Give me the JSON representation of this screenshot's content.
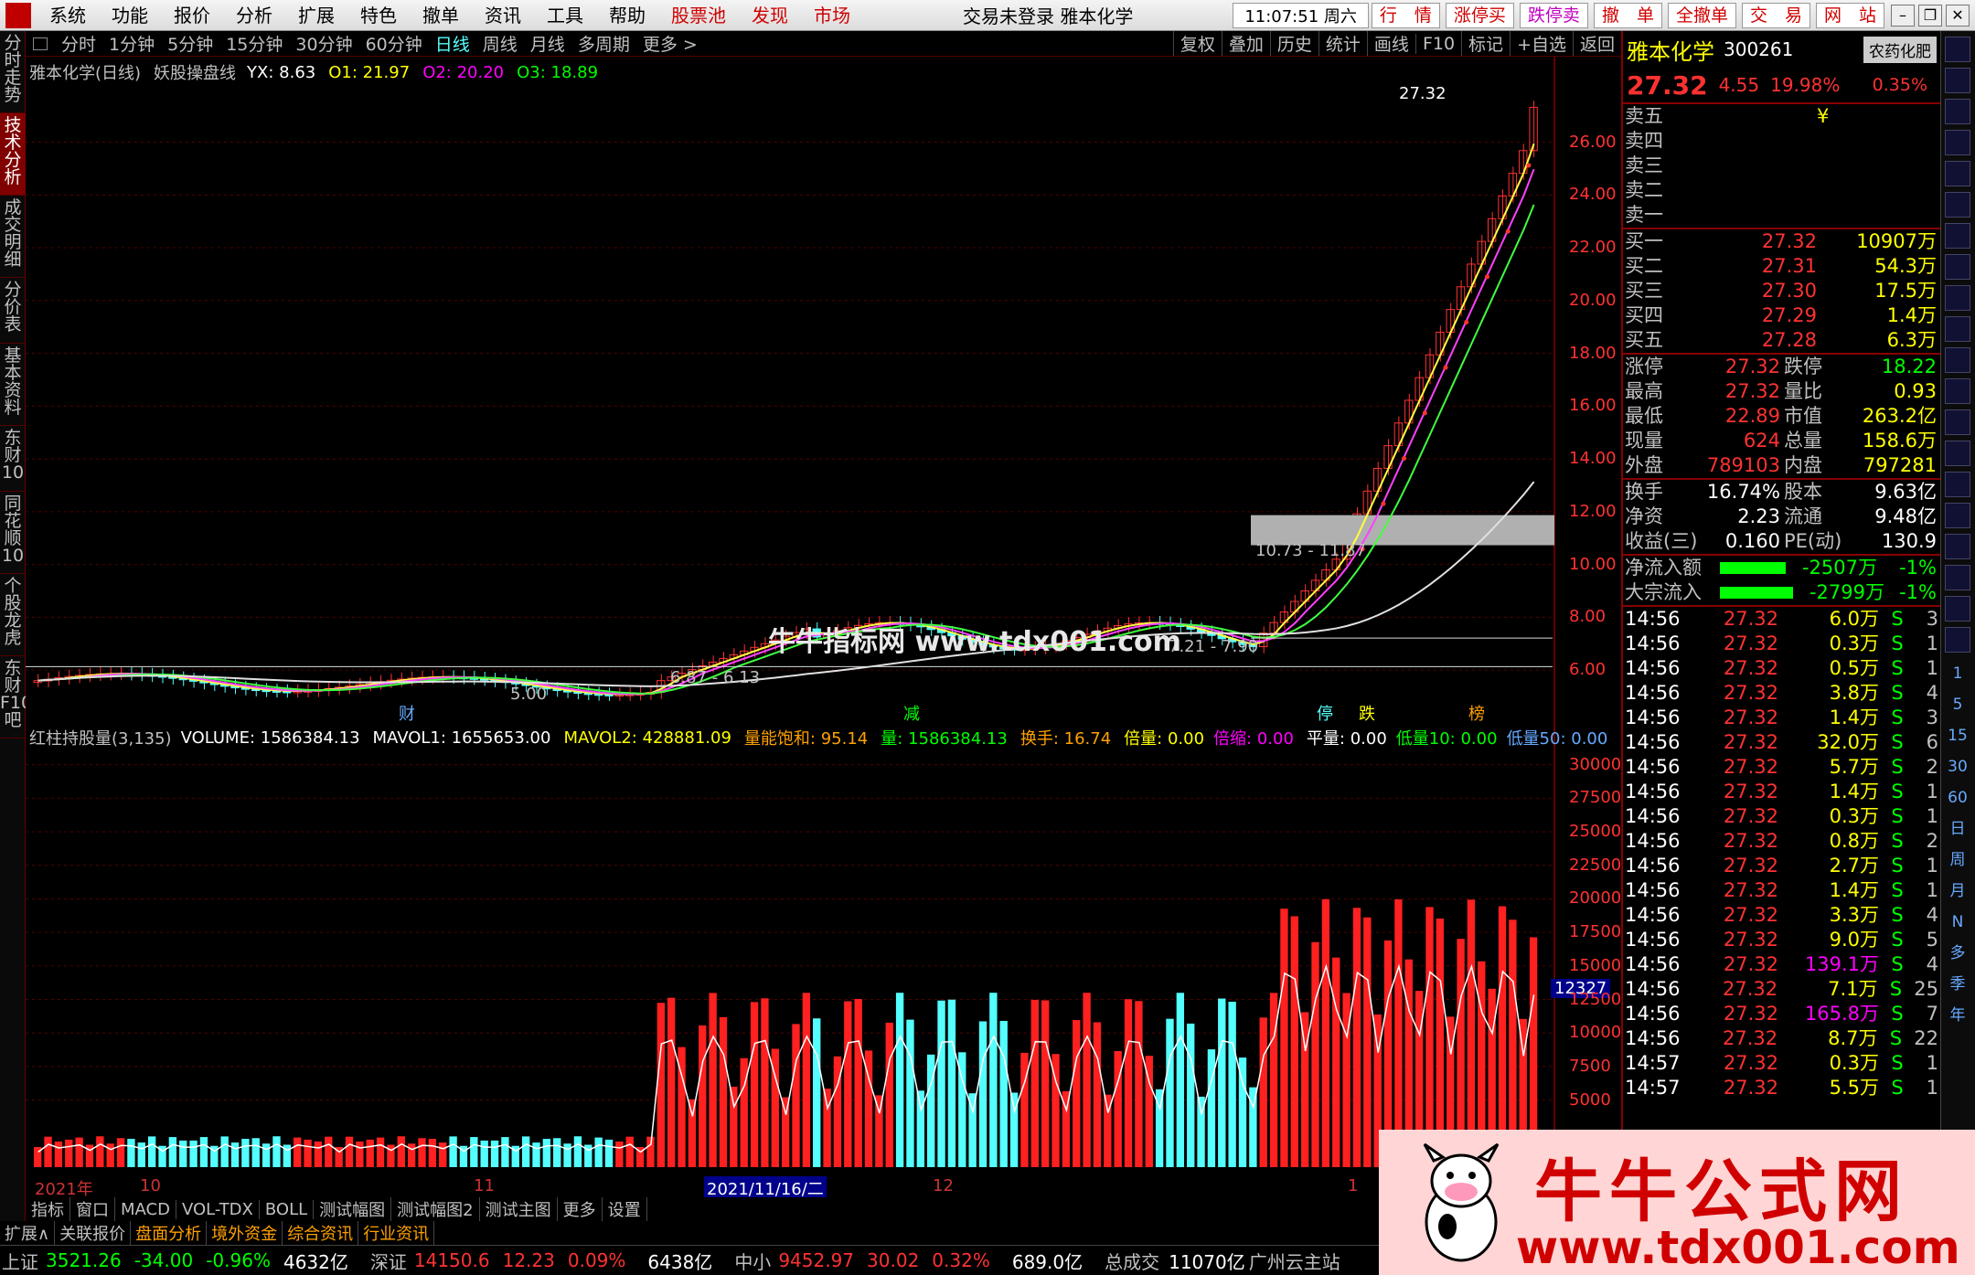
{
  "menu": {
    "items": [
      "系统",
      "功能",
      "报价",
      "分析",
      "扩展",
      "特色",
      "撤单",
      "资讯",
      "工具",
      "帮助"
    ],
    "red_items": [
      "股票池",
      "发现",
      "市场"
    ],
    "title": "交易未登录  雅本化学",
    "clock": "11:07:51 周六",
    "buttons": [
      "行　情",
      "涨停买",
      "跌停卖",
      "撤　单",
      "全撤单",
      "交　易",
      "网　站"
    ]
  },
  "left_tabs": [
    "分时走势",
    "技术分析",
    "成交明细",
    "分价表",
    "基本资料",
    "东财10",
    "同花顺10",
    "个股龙虎",
    "东财F10吧"
  ],
  "period": {
    "items": [
      "分时",
      "1分钟",
      "5分钟",
      "15分钟",
      "30分钟",
      "60分钟",
      "日线",
      "周线",
      "月线",
      "多周期",
      "更多 >"
    ],
    "active": "日线",
    "right": [
      "复权",
      "叠加",
      "历史",
      "统计",
      "画线",
      "F10",
      "标记",
      "+自选",
      "返回"
    ]
  },
  "main": {
    "stock": "雅本化学(日线)",
    "formula": "妖股操盘线",
    "yx": "YX: 8.63",
    "o1": "O1: 21.97",
    "o2": "O2: 20.20",
    "o3": "O3: 18.89",
    "price_ticks": [
      "26.00",
      "24.00",
      "22.00",
      "20.00",
      "18.00",
      "16.00",
      "14.00",
      "12.00",
      "10.00",
      "8.00",
      "6.00"
    ],
    "high_label": "27.32",
    "box_label": "10.73 - 11.87",
    "label_5_00": "5.00",
    "label_687": "6.87 - 6.13",
    "label_721": "7.21 - 7.90",
    "markers": [
      "财",
      "减",
      "停",
      "跌",
      "榜"
    ],
    "watermark": "牛牛指标网 www.tdx001.com"
  },
  "vol": {
    "name": "红柱持股量(3,135)",
    "volume": "VOLUME: 1586384.13",
    "mavol1": "MAVOL1: 1655653.00",
    "mavol2": "MAVOL2: 428881.09",
    "lnbh": "量能饱和: 95.14",
    "liang": "量: 1586384.13",
    "hs": "换手: 16.74",
    "bl": "倍量: 0.00",
    "bs": "倍缩: 0.00",
    "pl": "平量: 0.00",
    "dl": "低量10: 0.00",
    "xl": "低量50: 0.00",
    "ticks": [
      "30000",
      "27500",
      "25000",
      "22500",
      "20000",
      "17500",
      "15000",
      "12500",
      "10000",
      "7500",
      "5000"
    ],
    "cursor_val": "12327"
  },
  "dates": [
    "2021年",
    "10",
    "11",
    "2021/11/16/二",
    "12",
    "1"
  ],
  "tabs": [
    "指标",
    "窗口",
    "MACD",
    "VOL-TDX",
    "BOLL",
    "测试幅图",
    "测试幅图2",
    "测试主图",
    "更多",
    "设置"
  ],
  "sects": [
    "扩展∧",
    "关联报价",
    "盘面分析",
    "境外资金",
    "综合资讯",
    "行业资讯"
  ],
  "status": {
    "sh": "上证",
    "sh_v": "3521.26",
    "sh_c": "-34.00",
    "sh_p": "-0.96%",
    "sh_a": "4632亿",
    "sz": "深证",
    "sz_v": "14150.6",
    "sz_c": "12.23",
    "sz_p": "0.09%",
    "sz_a": "6438亿",
    "zx": "中小",
    "zx_v": "9452.97",
    "zx_c": "30.02",
    "zx_p": "0.32%",
    "zx_a": "689.0亿",
    "total": "总成交",
    "total_v": "11070亿",
    "site": "广州云主站"
  },
  "quote": {
    "name": "雅本化学",
    "code": "300261",
    "sector": "农药化肥",
    "price": "27.32",
    "chg": "4.55",
    "pct": "19.98%",
    "sector_pct": "0.35%",
    "asks": [
      {
        "l": "卖五",
        "p": "",
        "v": "¥"
      },
      {
        "l": "卖四",
        "p": "",
        "v": ""
      },
      {
        "l": "卖三",
        "p": "",
        "v": ""
      },
      {
        "l": "卖二",
        "p": "",
        "v": ""
      },
      {
        "l": "卖一",
        "p": "",
        "v": ""
      }
    ],
    "bids": [
      {
        "l": "买一",
        "p": "27.32",
        "v": "10907万"
      },
      {
        "l": "买二",
        "p": "27.31",
        "v": "54.3万"
      },
      {
        "l": "买三",
        "p": "27.30",
        "v": "17.5万"
      },
      {
        "l": "买四",
        "p": "27.29",
        "v": "1.4万"
      },
      {
        "l": "买五",
        "p": "27.28",
        "v": "6.3万"
      }
    ],
    "stats": [
      [
        "涨停",
        "27.32",
        "跌停",
        "18.22"
      ],
      [
        "最高",
        "27.32",
        "量比",
        "0.93"
      ],
      [
        "最低",
        "22.89",
        "市值",
        "263.2亿"
      ],
      [
        "现量",
        "624",
        "总量",
        "158.6万"
      ],
      [
        "外盘",
        "789103",
        "内盘",
        "797281"
      ]
    ],
    "stats2": [
      [
        "换手",
        "16.74%",
        "股本",
        "9.63亿"
      ],
      [
        "净资",
        "2.23",
        "流通",
        "9.48亿"
      ],
      [
        "收益(三)",
        "0.160",
        "PE(动)",
        "130.9"
      ]
    ],
    "flows": [
      {
        "l": "净流入额",
        "v": "-2507万",
        "p": "-1%"
      },
      {
        "l": "大宗流入",
        "v": "-2799万",
        "p": "-1%"
      }
    ],
    "ticks": [
      [
        "14:56",
        "27.32",
        "6.0万",
        "S",
        "3"
      ],
      [
        "14:56",
        "27.32",
        "0.3万",
        "S",
        "1"
      ],
      [
        "14:56",
        "27.32",
        "0.5万",
        "S",
        "1"
      ],
      [
        "14:56",
        "27.32",
        "3.8万",
        "S",
        "4"
      ],
      [
        "14:56",
        "27.32",
        "1.4万",
        "S",
        "3"
      ],
      [
        "14:56",
        "27.32",
        "32.0万",
        "S",
        "6"
      ],
      [
        "14:56",
        "27.32",
        "5.7万",
        "S",
        "2"
      ],
      [
        "14:56",
        "27.32",
        "1.4万",
        "S",
        "1"
      ],
      [
        "14:56",
        "27.32",
        "0.3万",
        "S",
        "1"
      ],
      [
        "14:56",
        "27.32",
        "0.8万",
        "S",
        "2"
      ],
      [
        "14:56",
        "27.32",
        "2.7万",
        "S",
        "1"
      ],
      [
        "14:56",
        "27.32",
        "1.4万",
        "S",
        "1"
      ],
      [
        "14:56",
        "27.32",
        "3.3万",
        "S",
        "4"
      ],
      [
        "14:56",
        "27.32",
        "9.0万",
        "S",
        "5"
      ],
      [
        "14:56",
        "27.32",
        "139.1万",
        "S",
        "4"
      ],
      [
        "14:56",
        "27.32",
        "7.1万",
        "S",
        "25"
      ],
      [
        "14:56",
        "27.32",
        "165.8万",
        "S",
        "7"
      ],
      [
        "14:56",
        "27.32",
        "8.7万",
        "S",
        "22"
      ],
      [
        "14:57",
        "27.32",
        "0.3万",
        "S",
        "1"
      ],
      [
        "14:57",
        "27.32",
        "5.5万",
        "S",
        "1"
      ]
    ]
  },
  "rtools": [
    "1",
    "5",
    "15",
    "30",
    "60",
    "日",
    "周",
    "月",
    "N",
    "多",
    "季",
    "年"
  ],
  "banner": {
    "title": "牛牛公式网",
    "url": "www.tdx001.com"
  },
  "chart_data": {
    "type": "candlestick",
    "price_range": [
      5,
      27.32
    ],
    "last": {
      "close": 27.32,
      "high": 27.32,
      "low": 22.89
    },
    "yx": 8.63,
    "o1": 21.97,
    "o2": 20.2,
    "o3": 18.89,
    "volume_range": [
      0,
      30000
    ]
  }
}
